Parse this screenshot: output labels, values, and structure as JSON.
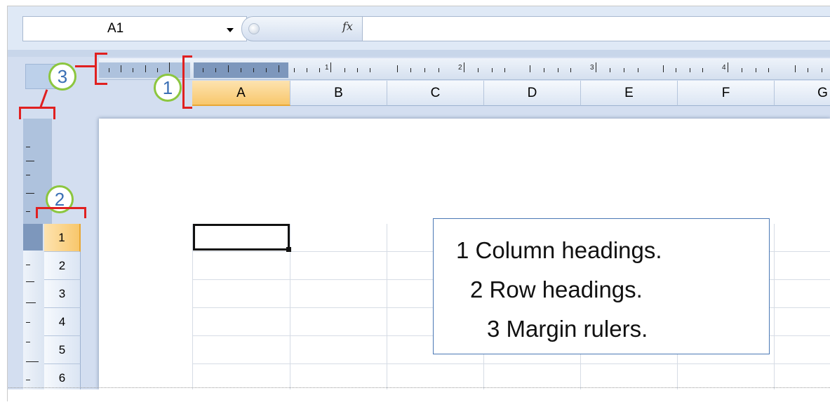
{
  "formula_bar": {
    "name_box": "A1",
    "fx_label": "fx",
    "formula_value": ""
  },
  "ruler": {
    "numbers": [
      "1",
      "2",
      "3",
      "4"
    ]
  },
  "columns": [
    "A",
    "B",
    "C",
    "D",
    "E",
    "F",
    "G"
  ],
  "selected_column": "A",
  "rows": [
    "1",
    "2",
    "3",
    "4",
    "5",
    "6"
  ],
  "selected_row": "1",
  "callouts": {
    "one": "1",
    "two": "2",
    "three": "3"
  },
  "legend": {
    "line1": "1  Column headings.",
    "line2": "2  Row headings.",
    "line3": "3  Margin rulers."
  },
  "colors": {
    "callout_border": "#8cc63f",
    "callout_text": "#3b6fb5",
    "bracket": "#e02020",
    "selected_header": "#f8c76c"
  }
}
